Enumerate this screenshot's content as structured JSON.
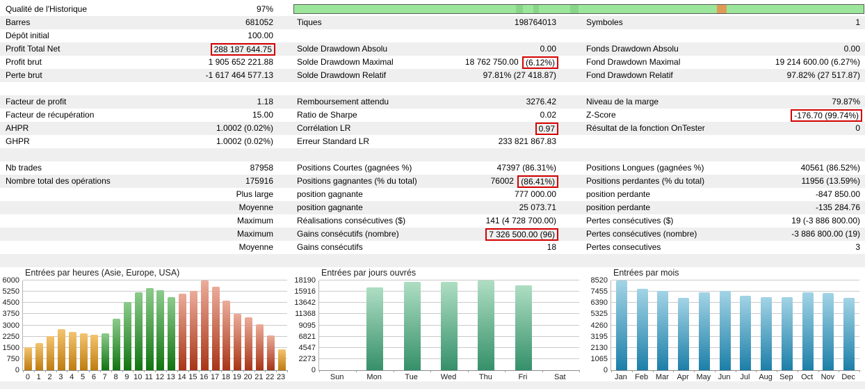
{
  "colors": {
    "stripe": "#efefef",
    "highlight_box": "#d40000",
    "progress_green": "#9be69b",
    "progress_orange": "#dd9c55",
    "grid": "#c9c9c9",
    "bar_asia_top": "#f3c46f",
    "bar_asia_bottom": "#bf7d10",
    "bar_europe_top": "#8ccb8c",
    "bar_europe_bottom": "#117511",
    "bar_usa_top": "#ecac9a",
    "bar_usa_bottom": "#a83517",
    "bar_day_top": "#afdec3",
    "bar_day_bottom": "#35906a",
    "bar_month_top": "#a3d4e6",
    "bar_month_bottom": "#1c7fa8"
  },
  "progress": {
    "quality_percent": "97%",
    "segments": [
      {
        "left_pct": 39.0,
        "width_pct": 1.2,
        "type": "dark"
      },
      {
        "left_pct": 42.0,
        "width_pct": 1.0,
        "type": "dark"
      },
      {
        "left_pct": 48.5,
        "width_pct": 1.5,
        "type": "dark"
      },
      {
        "left_pct": 74.2,
        "width_pct": 1.8,
        "type": "orange"
      }
    ]
  },
  "stats_rows": [
    {
      "shade": false,
      "cells": [
        {
          "label": "Qualité de l'Historique",
          "pre": "97%"
        },
        {
          "progress": true
        },
        null
      ]
    },
    {
      "shade": true,
      "cells": [
        {
          "label": "Barres",
          "pre": "681052"
        },
        {
          "label": "Tiques",
          "pre": "198764013"
        },
        {
          "label": "Symboles",
          "pre": "1"
        }
      ]
    },
    {
      "shade": false,
      "cells": [
        {
          "label": "Dépôt initial",
          "pre": "100.00"
        },
        null,
        null
      ]
    },
    {
      "shade": true,
      "cells": [
        {
          "label": "Profit Total Net",
          "pre": "",
          "boxed": "288 187 644.75"
        },
        {
          "label": "Solde Drawdown Absolu",
          "pre": "0.00"
        },
        {
          "label": "Fonds Drawdown Absolu",
          "pre": "0.00"
        }
      ]
    },
    {
      "shade": false,
      "cells": [
        {
          "label": "Profit brut",
          "pre": "1 905 652 221.88"
        },
        {
          "label": "Solde Drawdown Maximal",
          "pre": "18 762 750.00 ",
          "boxed": "(6.12%)"
        },
        {
          "label": "Fond Drawdown Maximal",
          "pre": "19 214 600.00 (6.27%)"
        }
      ]
    },
    {
      "shade": true,
      "cells": [
        {
          "label": "Perte brut",
          "pre": "-1 617 464 577.13"
        },
        {
          "label": "Solde Drawdown Relatif",
          "pre": "97.81% (27 418.87)"
        },
        {
          "label": "Fond Drawdown Relatif",
          "pre": "97.82% (27 517.87)"
        }
      ]
    },
    {
      "shade": false,
      "cells": [
        null,
        null,
        null
      ]
    },
    {
      "shade": true,
      "cells": [
        {
          "label": "Facteur de profit",
          "pre": "1.18"
        },
        {
          "label": "Remboursement attendu",
          "pre": "3276.42"
        },
        {
          "label": "Niveau de la marge",
          "pre": "79.87%"
        }
      ]
    },
    {
      "shade": false,
      "cells": [
        {
          "label": "Facteur de récupération",
          "pre": "15.00"
        },
        {
          "label": "Ratio de Sharpe",
          "pre": "0.02"
        },
        {
          "label": "Z-Score",
          "pre": "",
          "boxed": "-176.70 (99.74%)"
        }
      ]
    },
    {
      "shade": true,
      "cells": [
        {
          "label": "AHPR",
          "pre": "1.0002 (0.02%)"
        },
        {
          "label": "Corrélation LR",
          "pre": "",
          "boxed": "0.97"
        },
        {
          "label": "Résultat de la fonction OnTester",
          "pre": "0"
        }
      ]
    },
    {
      "shade": false,
      "cells": [
        {
          "label": "GHPR",
          "pre": "1.0002 (0.02%)"
        },
        {
          "label": "Erreur Standard LR",
          "pre": "233 821 867.83"
        },
        null
      ]
    },
    {
      "shade": true,
      "cells": [
        null,
        null,
        null
      ]
    },
    {
      "shade": false,
      "cells": [
        {
          "label": "Nb trades",
          "pre": "87958"
        },
        {
          "label": "Positions Courtes (gagnées %)",
          "pre": "47397 (86.31%)"
        },
        {
          "label": "Positions Longues (gagnées %)",
          "pre": "40561 (86.52%)"
        }
      ]
    },
    {
      "shade": true,
      "cells": [
        {
          "label": "Nombre total des opérations",
          "pre": "175916"
        },
        {
          "label": "Positions gagnantes (% du total)",
          "pre": "76002 ",
          "boxed": "(86.41%)"
        },
        {
          "label": "Positions perdantes (% du total)",
          "pre": "11956 (13.59%)"
        }
      ]
    },
    {
      "shade": false,
      "cells": [
        {
          "label": "",
          "pre": "Plus large"
        },
        {
          "label": "position gagnante",
          "pre": "777 000.00"
        },
        {
          "label": "position perdante",
          "pre": "-847 850.00"
        }
      ]
    },
    {
      "shade": true,
      "cells": [
        {
          "label": "",
          "pre": "Moyenne"
        },
        {
          "label": "position gagnante",
          "pre": "25 073.71"
        },
        {
          "label": "position perdante",
          "pre": "-135 284.76"
        }
      ]
    },
    {
      "shade": false,
      "cells": [
        {
          "label": "",
          "pre": "Maximum"
        },
        {
          "label": "Réalisations consécutives ($)",
          "pre": "141 (4 728 700.00)"
        },
        {
          "label": "Pertes consécutives ($)",
          "pre": "19 (-3 886 800.00)"
        }
      ]
    },
    {
      "shade": true,
      "cells": [
        {
          "label": "",
          "pre": "Maximum"
        },
        {
          "label": "Gains consécutifs (nombre)",
          "pre": "",
          "boxed": "7 326 500.00 (96)"
        },
        {
          "label": "Pertes consécutives (nombre)",
          "pre": "-3 886 800.00 (19)"
        }
      ]
    },
    {
      "shade": false,
      "cells": [
        {
          "label": "",
          "pre": "Moyenne"
        },
        {
          "label": "Gains consécutifs",
          "pre": "18"
        },
        {
          "label": "Pertes consecutives",
          "pre": "3"
        }
      ]
    },
    {
      "shade": true,
      "cells": [
        null,
        null,
        null
      ]
    }
  ],
  "chart_data": [
    {
      "id": "hours",
      "type": "bar",
      "title": "Entrées par heures (Asie, Europe, USA)",
      "xlabel": "",
      "ylabel": "",
      "grid": true,
      "legend": "none",
      "categories": [
        "0",
        "1",
        "2",
        "3",
        "4",
        "5",
        "6",
        "7",
        "8",
        "9",
        "10",
        "11",
        "12",
        "13",
        "14",
        "15",
        "16",
        "17",
        "18",
        "19",
        "20",
        "21",
        "22",
        "23"
      ],
      "values": [
        1550,
        1820,
        2300,
        2730,
        2560,
        2450,
        2380,
        2480,
        3460,
        4550,
        5220,
        5490,
        5330,
        4890,
        5100,
        5280,
        6000,
        5600,
        4630,
        3770,
        3540,
        3070,
        2320,
        1400
      ],
      "bar_groups": [
        "asia",
        "asia",
        "asia",
        "asia",
        "asia",
        "asia",
        "asia",
        "europe",
        "europe",
        "europe",
        "europe",
        "europe",
        "europe",
        "europe",
        "usa",
        "usa",
        "usa",
        "usa",
        "usa",
        "usa",
        "usa",
        "usa",
        "usa",
        "asia"
      ],
      "yticks": [
        0,
        750,
        1500,
        2250,
        3000,
        3750,
        4500,
        5250,
        6000
      ],
      "ylim": [
        0,
        6000
      ]
    },
    {
      "id": "days",
      "type": "bar",
      "title": "Entrées par jours ouvrés",
      "xlabel": "",
      "ylabel": "",
      "grid": true,
      "legend": "none",
      "palette": "day",
      "categories": [
        "Sun",
        "Mon",
        "Tue",
        "Wed",
        "Thu",
        "Fri",
        "Sat"
      ],
      "values": [
        0,
        16800,
        17900,
        17900,
        18190,
        17250,
        0
      ],
      "yticks": [
        0,
        2273,
        4547,
        6821,
        9095,
        11368,
        13642,
        15916,
        18190
      ],
      "ylim": [
        0,
        18190
      ]
    },
    {
      "id": "months",
      "type": "bar",
      "title": "Entrées par mois",
      "xlabel": "",
      "ylabel": "",
      "grid": true,
      "legend": "none",
      "palette": "month",
      "categories": [
        "Jan",
        "Feb",
        "Mar",
        "Apr",
        "May",
        "Jun",
        "Jul",
        "Aug",
        "Sep",
        "Oct",
        "Nov",
        "Dec"
      ],
      "values": [
        8520,
        7720,
        7520,
        6870,
        7430,
        7520,
        7070,
        6940,
        6960,
        7390,
        7300,
        6870
      ],
      "yticks": [
        0,
        1065,
        2130,
        3195,
        4260,
        5325,
        6390,
        7455,
        8520
      ],
      "ylim": [
        0,
        8520
      ]
    }
  ]
}
